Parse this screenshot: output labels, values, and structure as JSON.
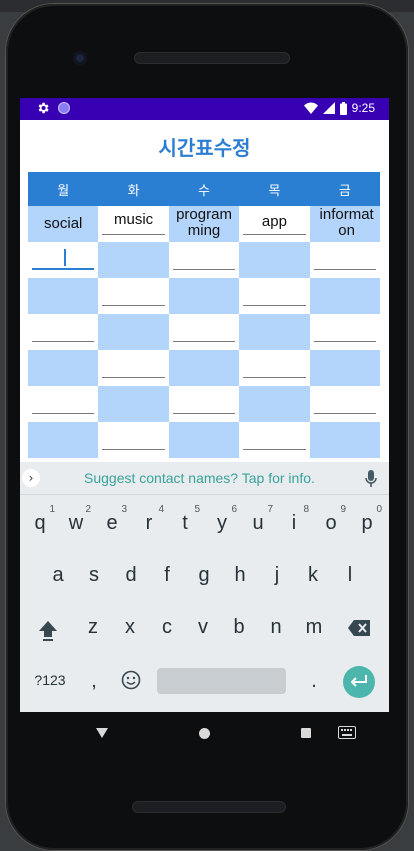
{
  "status_bar": {
    "time": "9:25"
  },
  "screen": {
    "title": "시간표수정"
  },
  "timetable": {
    "days": [
      "월",
      "화",
      "수",
      "목",
      "금"
    ],
    "row1": [
      "social",
      "music",
      "program\nming",
      "app",
      "informat\non"
    ],
    "cursor_cell": ""
  },
  "keyboard": {
    "suggestion": "Suggest contact names? Tap for info.",
    "row1": [
      "q",
      "w",
      "e",
      "r",
      "t",
      "y",
      "u",
      "i",
      "o",
      "p"
    ],
    "row1_nums": [
      "1",
      "2",
      "3",
      "4",
      "5",
      "6",
      "7",
      "8",
      "9",
      "0"
    ],
    "row2": [
      "a",
      "s",
      "d",
      "f",
      "g",
      "h",
      "j",
      "k",
      "l"
    ],
    "row3": [
      "z",
      "x",
      "c",
      "v",
      "b",
      "n",
      "m"
    ],
    "mode_key": "?123",
    "comma": ",",
    "period": "."
  },
  "colors": {
    "status_bar": "#3700b3",
    "accent": "#2b7fd3",
    "cell_blue": "#b3d4fb",
    "enter": "#4db6ac"
  },
  "icons": [
    "gear-icon",
    "circle-icon",
    "wifi-icon",
    "signal-icon",
    "battery-icon",
    "chevron-right-icon",
    "mic-icon",
    "shift-icon",
    "backspace-icon",
    "emoji-icon",
    "enter-icon",
    "nav-back-icon",
    "nav-home-icon",
    "nav-recents-icon",
    "nav-keyboard-icon"
  ]
}
